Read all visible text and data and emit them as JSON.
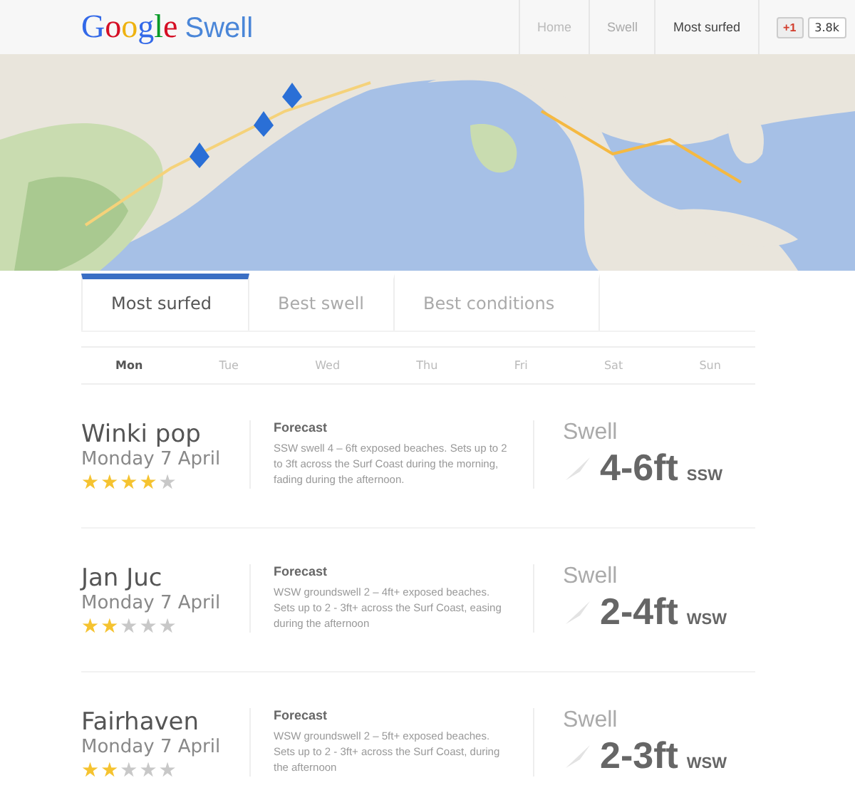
{
  "header": {
    "logo": "Google",
    "product": "Swell",
    "nav": [
      {
        "label": "Home",
        "selected": false
      },
      {
        "label": "Swell",
        "selected": false
      },
      {
        "label": "Most surfed",
        "selected": true
      }
    ],
    "plus_one": "+1",
    "count": "3.8k"
  },
  "tabs": [
    {
      "label": "Most surfed",
      "selected": true
    },
    {
      "label": "Best swell",
      "selected": false
    },
    {
      "label": "Best conditions",
      "selected": false
    }
  ],
  "days": [
    {
      "label": "Mon",
      "selected": true
    },
    {
      "label": "Tue",
      "selected": false
    },
    {
      "label": "Wed",
      "selected": false
    },
    {
      "label": "Thu",
      "selected": false
    },
    {
      "label": "Fri",
      "selected": false
    },
    {
      "label": "Sat",
      "selected": false
    },
    {
      "label": "Sun",
      "selected": false
    }
  ],
  "spots": [
    {
      "name": "Winki pop",
      "date": "Monday 7 April",
      "stars": 4,
      "forecast_title": "Forecast",
      "forecast": "SSW swell 4 – 6ft exposed beaches. Sets up to 2 to 3ft across the Surf Coast during the morning, fading during the afternoon.",
      "swell_label": "Swell",
      "height": "4-6ft",
      "direction": "SSW"
    },
    {
      "name": "Jan Juc",
      "date": "Monday 7 April",
      "stars": 2,
      "forecast_title": "Forecast",
      "forecast": "WSW groundswell 2 – 4ft+ exposed beaches. Sets up to 2 - 3ft+ across the Surf Coast, easing during the afternoon",
      "swell_label": "Swell",
      "height": "2-4ft",
      "direction": "WSW"
    },
    {
      "name": "Fairhaven",
      "date": "Monday 7 April",
      "stars": 2,
      "forecast_title": "Forecast",
      "forecast": "WSW groundswell 2 – 5ft+ exposed beaches. Sets up to 2 - 3ft+ across the Surf Coast, during the afternoon",
      "swell_label": "Swell",
      "height": "2-3ft",
      "direction": "WSW"
    }
  ]
}
